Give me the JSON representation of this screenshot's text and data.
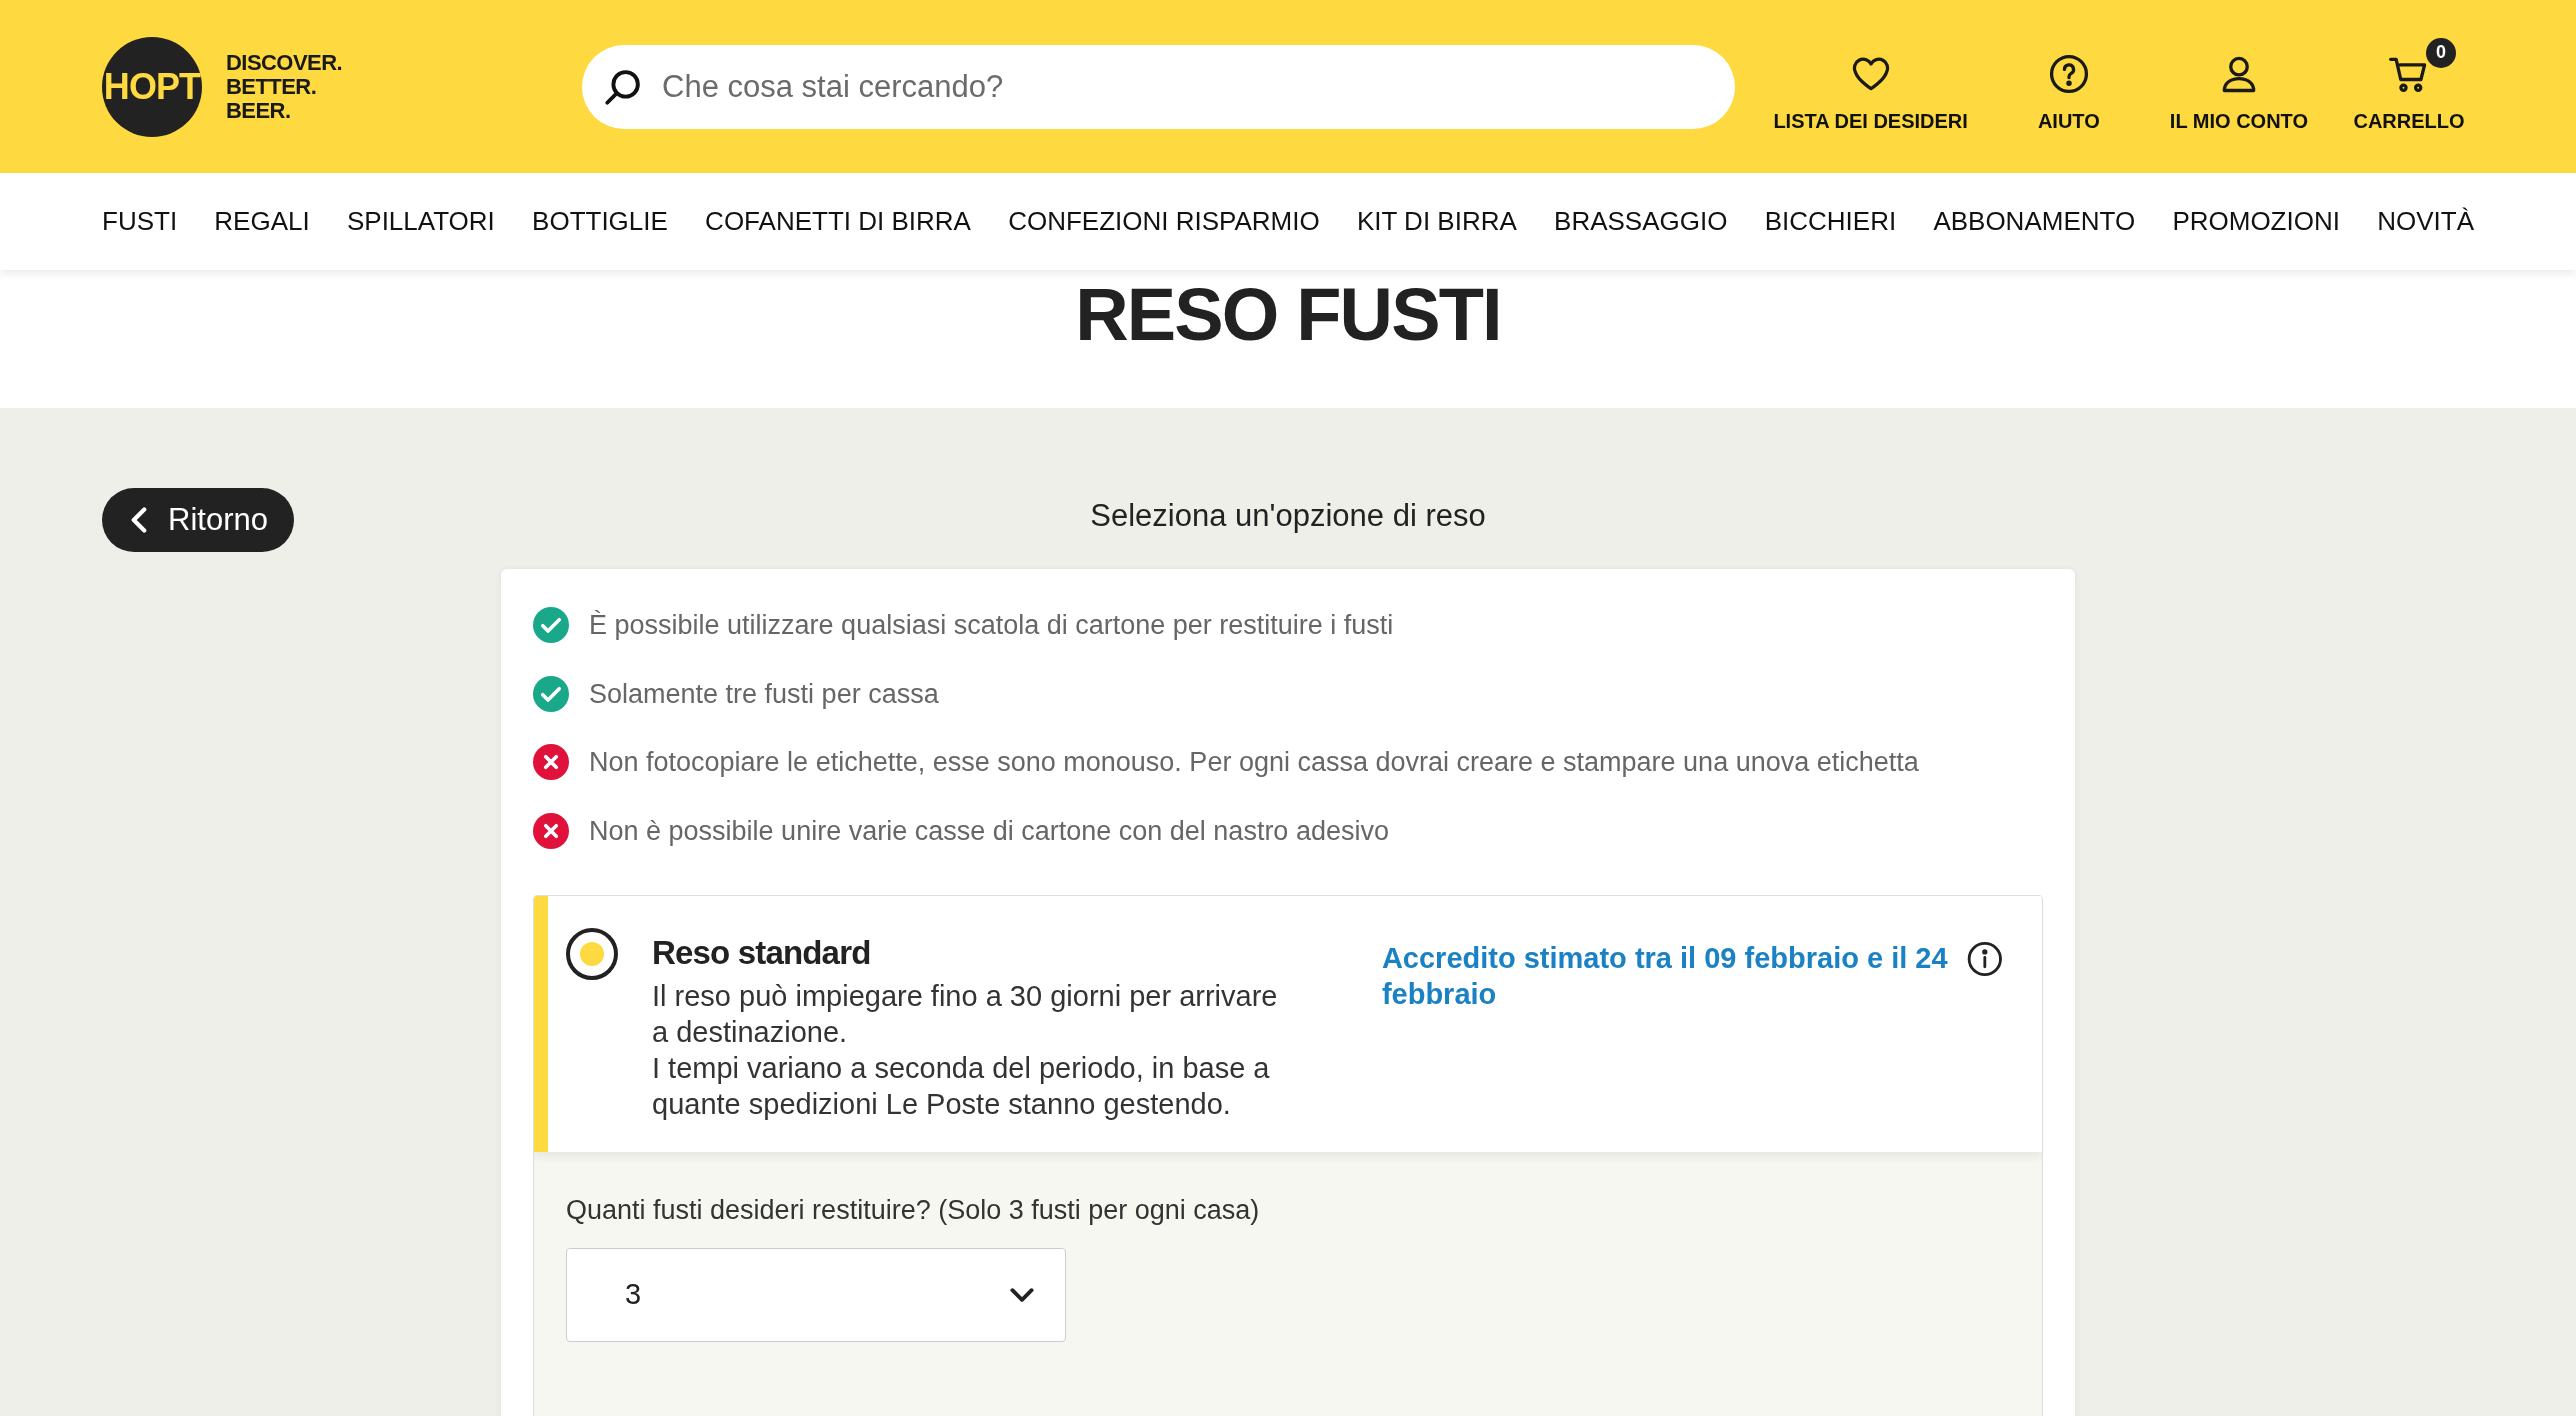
{
  "logo": {
    "mark": "HOPT",
    "tagline": [
      "DISCOVER.",
      "BETTER.",
      "BEER."
    ]
  },
  "search": {
    "placeholder": "Che cosa stai cercando?"
  },
  "header_actions": [
    {
      "kind": "heart",
      "label": "LISTA DEI DESIDERI"
    },
    {
      "kind": "help",
      "label": "AIUTO"
    },
    {
      "kind": "user",
      "label": "IL MIO CONTO"
    },
    {
      "kind": "cart",
      "label": "CARRELLO",
      "badge": "0"
    }
  ],
  "nav": [
    "FUSTI",
    "REGALI",
    "SPILLATORI",
    "BOTTIGLIE",
    "COFANETTI DI BIRRA",
    "CONFEZIONI RISPARMIO",
    "KIT DI BIRRA",
    "BRASSAGGIO",
    "BICCHIERI",
    "ABBONAMENTO",
    "PROMOZIONI",
    "NOVITÀ"
  ],
  "page_title": "RESO FUSTI",
  "back_button": "Ritorno",
  "subtitle": "Seleziona un'opzione di reso",
  "rules": [
    {
      "kind": "allowed",
      "text": "È possibile utilizzare qualsiasi scatola di cartone per restituire i fusti"
    },
    {
      "kind": "allowed",
      "text": "Solamente tre fusti per cassa"
    },
    {
      "kind": "forbidden",
      "text": "Non fotocopiare le etichette, esse sono monouso. Per ogni cassa dovrai creare e stampare una unova etichetta"
    },
    {
      "kind": "forbidden",
      "text": "Non è possibile unire varie casse di cartone con del nastro adesivo"
    }
  ],
  "option": {
    "title": "Reso standard",
    "selected": true,
    "description": [
      "Il reso può impiegare fino a 30 giorni per arrivare a destinazione.",
      "I tempi variano a seconda del periodo, in base a quante spedizioni Le Poste stanno gestendo."
    ],
    "estimate": "Accredito stimato tra il 09 febbraio e il 24 febbraio"
  },
  "quantity": {
    "label": "Quanti fusti desideri restituire? (Solo 3 fusti per ogni casa)",
    "value": "3"
  }
}
